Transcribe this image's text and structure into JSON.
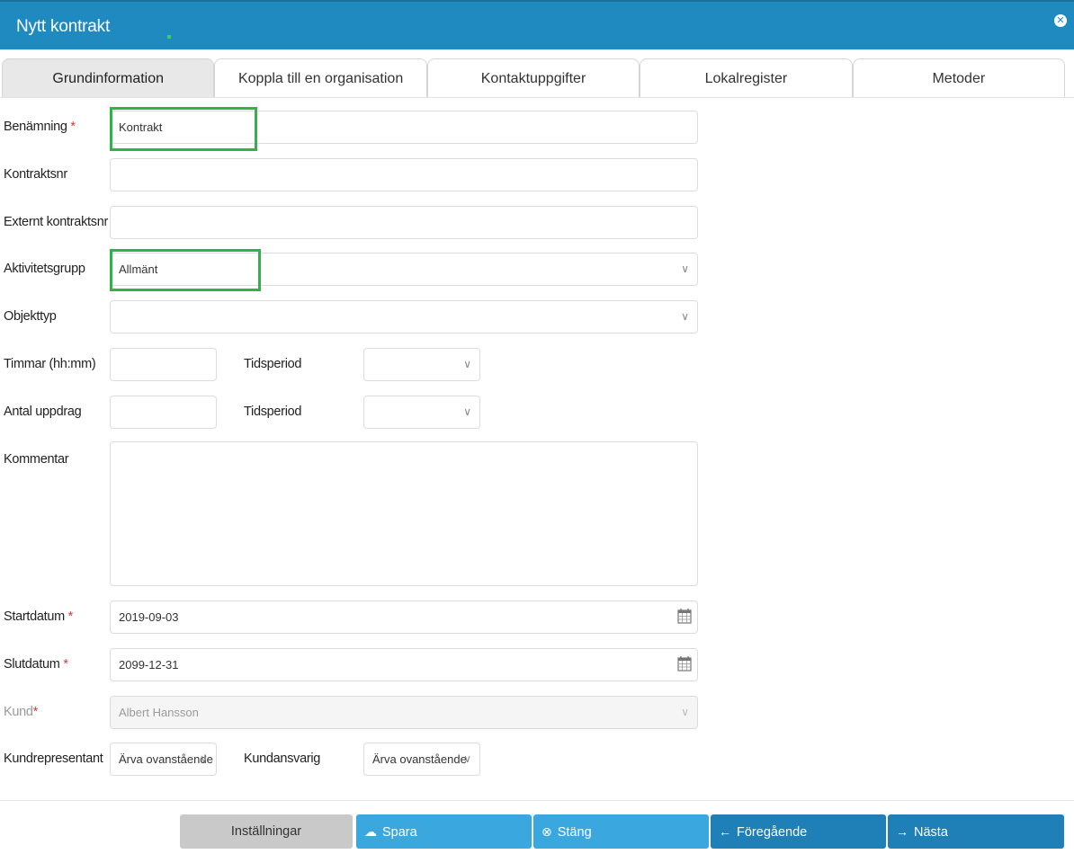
{
  "window": {
    "title": "Nytt kontrakt",
    "close_icon": "close-circle-icon"
  },
  "tabs": [
    {
      "label": "Grundinformation",
      "active": true
    },
    {
      "label": "Koppla till en organisation",
      "active": false
    },
    {
      "label": "Kontaktuppgifter",
      "active": false
    },
    {
      "label": "Lokalregister",
      "active": false
    },
    {
      "label": "Metoder",
      "active": false
    }
  ],
  "form": {
    "benamning": {
      "label": "Benämning",
      "required_mark": "*",
      "value": "Kontrakt"
    },
    "kontraktsnr": {
      "label": "Kontraktsnr",
      "value": ""
    },
    "externt_kontraktsnr": {
      "label": "Externt kontraktsnr",
      "value": ""
    },
    "aktivitetsgrupp": {
      "label": "Aktivitetsgrupp",
      "value": "Allmänt"
    },
    "objekttyp": {
      "label": "Objekttyp",
      "value": ""
    },
    "timmar": {
      "label": "Timmar (hh:mm)",
      "value": "",
      "period_label": "Tidsperiod",
      "period_value": ""
    },
    "antal_uppdrag": {
      "label": "Antal uppdrag",
      "value": "",
      "period_label": "Tidsperiod",
      "period_value": ""
    },
    "kommentar": {
      "label": "Kommentar",
      "value": ""
    },
    "startdatum": {
      "label": "Startdatum",
      "required_mark": "*",
      "value": "2019-09-03"
    },
    "slutdatum": {
      "label": "Slutdatum",
      "required_mark": "*",
      "value": "2099-12-31"
    },
    "kund": {
      "label": "Kund",
      "required_mark": "*",
      "value": "Albert Hansson",
      "disabled": true
    },
    "kundrepresentant": {
      "label": "Kundrepresentant",
      "value": "Ärva ovanstående"
    },
    "kundansvarig": {
      "label": "Kundansvarig",
      "value": "Ärva ovanstående"
    }
  },
  "buttons": {
    "installningar": "Inställningar",
    "spara": "Spara",
    "stang": "Stäng",
    "foregaende": "Föregående",
    "nasta": "Nästa"
  },
  "colors": {
    "titlebar": "#1f8ac0",
    "highlight": "#33b24a",
    "required": "#d23a3a",
    "button_light_blue": "#3aa8de",
    "button_dark_blue": "#1e80b6"
  }
}
